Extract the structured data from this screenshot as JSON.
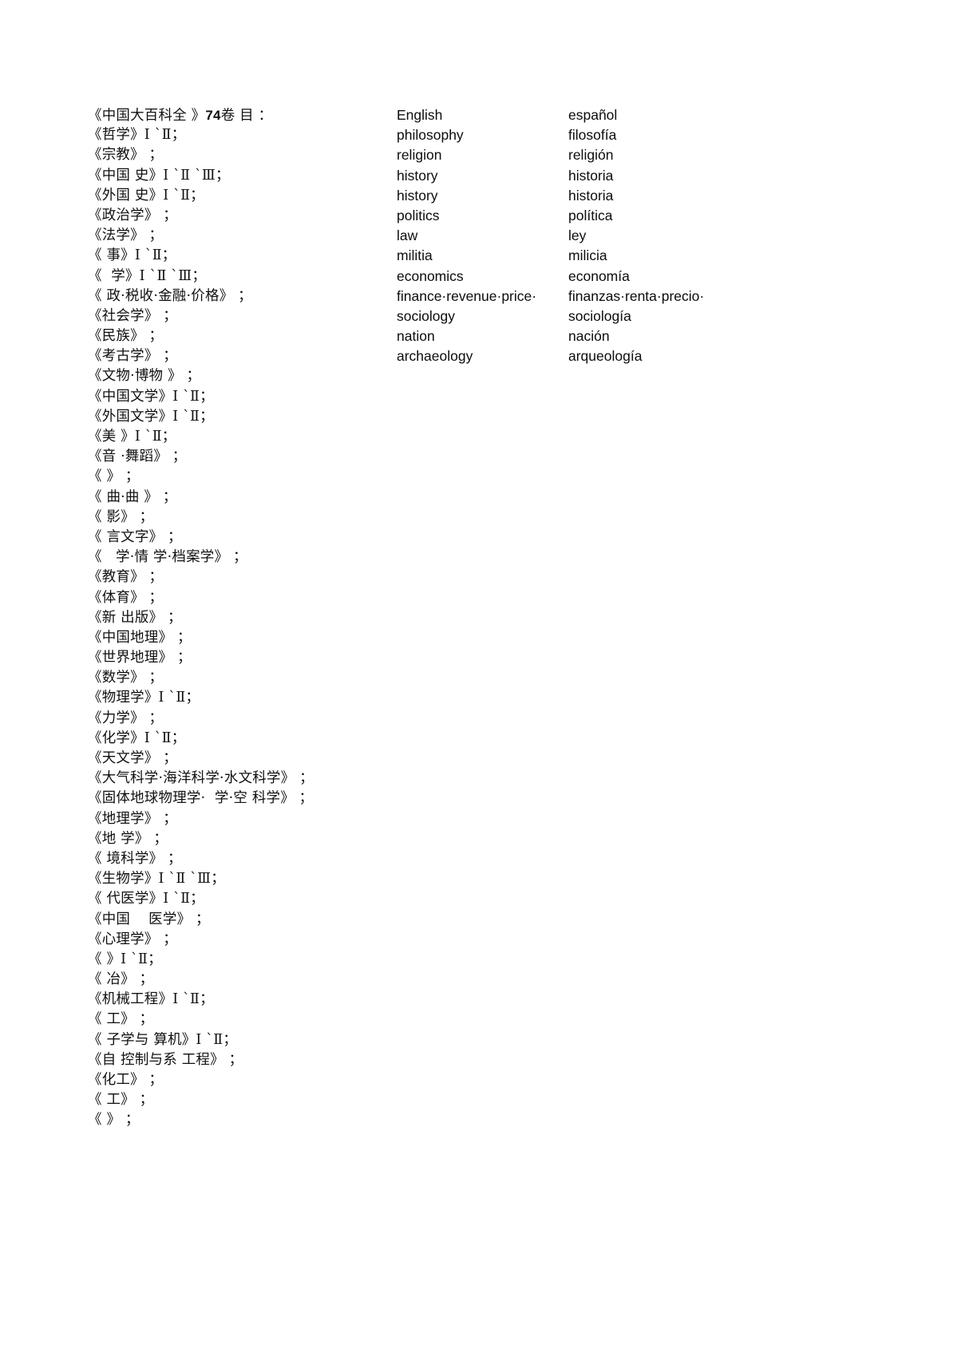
{
  "document": {
    "title_line": "《中国大百科全 》74卷 目 ：",
    "title_prefix": "《中国大百科全 》",
    "volume_count": "74",
    "title_suffix": "卷 目 ：",
    "column_headers": {
      "english": "English",
      "spanish": "español"
    }
  },
  "rows": [
    {
      "zh": "《哲学》Ⅰ `Ⅱ；",
      "en": "philosophy",
      "es": "filosofía"
    },
    {
      "zh": "《宗教》 ；",
      "en": "religion",
      "es": "religión"
    },
    {
      "zh": "《中国 史》Ⅰ `Ⅱ `Ⅲ；",
      "en": "history",
      "es": "historia"
    },
    {
      "zh": "《外国 史》Ⅰ `Ⅱ；",
      "en": "history",
      "es": "historia"
    },
    {
      "zh": "《政治学》 ；",
      "en": "politics",
      "es": "política"
    },
    {
      "zh": "《法学》 ；",
      "en": "law",
      "es": "ley"
    },
    {
      "zh": "《 事》Ⅰ `Ⅱ；",
      "en": "militia",
      "es": "milicia"
    },
    {
      "zh": "《  学》Ⅰ `Ⅱ `Ⅲ；",
      "en": "economics",
      "es": "economía"
    },
    {
      "zh": "《 政·税收·金融·价格》 ；",
      "en": "finance·revenue·price·",
      "es": "finanzas·renta·precio·"
    },
    {
      "zh": "《社会学》 ；",
      "en": "sociology",
      "es": "sociología"
    },
    {
      "zh": "《民族》 ；",
      "en": "nation",
      "es": "nación"
    },
    {
      "zh": "《考古学》 ；",
      "en": "archaeology",
      "es": "arqueología"
    },
    {
      "zh": "《文物·博物 》 ；",
      "en": "",
      "es": ""
    },
    {
      "zh": "《中国文学》Ⅰ `Ⅱ；",
      "en": "",
      "es": ""
    },
    {
      "zh": "《外国文学》Ⅰ `Ⅱ；",
      "en": "",
      "es": ""
    },
    {
      "zh": "《美 》Ⅰ `Ⅱ；",
      "en": "",
      "es": ""
    },
    {
      "zh": "《音 ·舞蹈》 ；",
      "en": "",
      "es": ""
    },
    {
      "zh": "《 》 ；",
      "en": "",
      "es": ""
    },
    {
      "zh": "《 曲·曲 》 ；",
      "en": "",
      "es": ""
    },
    {
      "zh": "《 影》 ；",
      "en": "",
      "es": ""
    },
    {
      "zh": "《 言文字》 ；",
      "en": "",
      "es": ""
    },
    {
      "zh": "《   学·情 学·档案学》 ；",
      "en": "",
      "es": ""
    },
    {
      "zh": "《教育》 ；",
      "en": "",
      "es": ""
    },
    {
      "zh": "《体育》 ；",
      "en": "",
      "es": ""
    },
    {
      "zh": "《新 出版》 ；",
      "en": "",
      "es": ""
    },
    {
      "zh": "《中国地理》 ；",
      "en": "",
      "es": ""
    },
    {
      "zh": "《世界地理》 ；",
      "en": "",
      "es": ""
    },
    {
      "zh": "《数学》 ；",
      "en": "",
      "es": ""
    },
    {
      "zh": "《物理学》Ⅰ `Ⅱ；",
      "en": "",
      "es": ""
    },
    {
      "zh": "《力学》 ；",
      "en": "",
      "es": ""
    },
    {
      "zh": "《化学》Ⅰ `Ⅱ；",
      "en": "",
      "es": ""
    },
    {
      "zh": "《天文学》 ；",
      "en": "",
      "es": ""
    },
    {
      "zh": "《大气科学·海洋科学·水文科学》 ；",
      "en": "",
      "es": ""
    },
    {
      "zh": "《固体地球物理学·  学·空 科学》 ；",
      "en": "",
      "es": ""
    },
    {
      "zh": "《地理学》 ；",
      "en": "",
      "es": ""
    },
    {
      "zh": "《地 学》 ；",
      "en": "",
      "es": ""
    },
    {
      "zh": "《 境科学》 ；",
      "en": "",
      "es": ""
    },
    {
      "zh": "《生物学》Ⅰ `Ⅱ `Ⅲ；",
      "en": "",
      "es": ""
    },
    {
      "zh": "《 代医学》Ⅰ `Ⅱ；",
      "en": "",
      "es": ""
    },
    {
      "zh": "《中国    医学》 ；",
      "en": "",
      "es": ""
    },
    {
      "zh": "《心理学》 ；",
      "en": "",
      "es": ""
    },
    {
      "zh": "《 》Ⅰ `Ⅱ；",
      "en": "",
      "es": ""
    },
    {
      "zh": "《 冶》 ；",
      "en": "",
      "es": ""
    },
    {
      "zh": "《机械工程》Ⅰ `Ⅱ；",
      "en": "",
      "es": ""
    },
    {
      "zh": "《 工》 ；",
      "en": "",
      "es": ""
    },
    {
      "zh": "《 子学与 算机》Ⅰ `Ⅱ；",
      "en": "",
      "es": ""
    },
    {
      "zh": "《自 控制与系 工程》 ；",
      "en": "",
      "es": ""
    },
    {
      "zh": "《化工》 ；",
      "en": "",
      "es": ""
    },
    {
      "zh": "《 工》 ；",
      "en": "",
      "es": ""
    },
    {
      "zh": "《 》 ；",
      "en": "",
      "es": ""
    }
  ]
}
